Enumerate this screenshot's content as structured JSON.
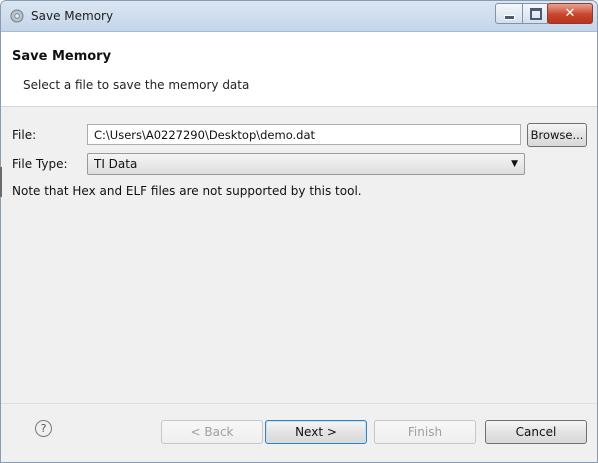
{
  "window": {
    "title": "Save Memory"
  },
  "banner": {
    "title": "Save Memory",
    "description": "Select a file to save the memory data"
  },
  "form": {
    "file_label": "File:",
    "file_value": "C:\\Users\\A0227290\\Desktop\\demo.dat",
    "browse_label": "Browse...",
    "file_type_label": "File Type:",
    "file_type_value": "TI Data",
    "note": "Note that Hex and ELF files are not supported by this tool."
  },
  "footer": {
    "help_glyph": "?",
    "back_label": "< Back",
    "next_label": "Next >",
    "finish_label": "Finish",
    "cancel_label": "Cancel"
  },
  "icons": {
    "app": "gear-icon",
    "minimize": "minimize-icon",
    "maximize": "maximize-icon",
    "close": "close-icon",
    "dropdown": "chevron-down-icon",
    "help": "help-icon"
  },
  "colors": {
    "title_bar": "#c4d6ea",
    "close_button": "#c9452d",
    "dialog_background": "#f0f0f0",
    "banner_background": "#ffffff",
    "default_button_border": "#3c7fb1"
  }
}
